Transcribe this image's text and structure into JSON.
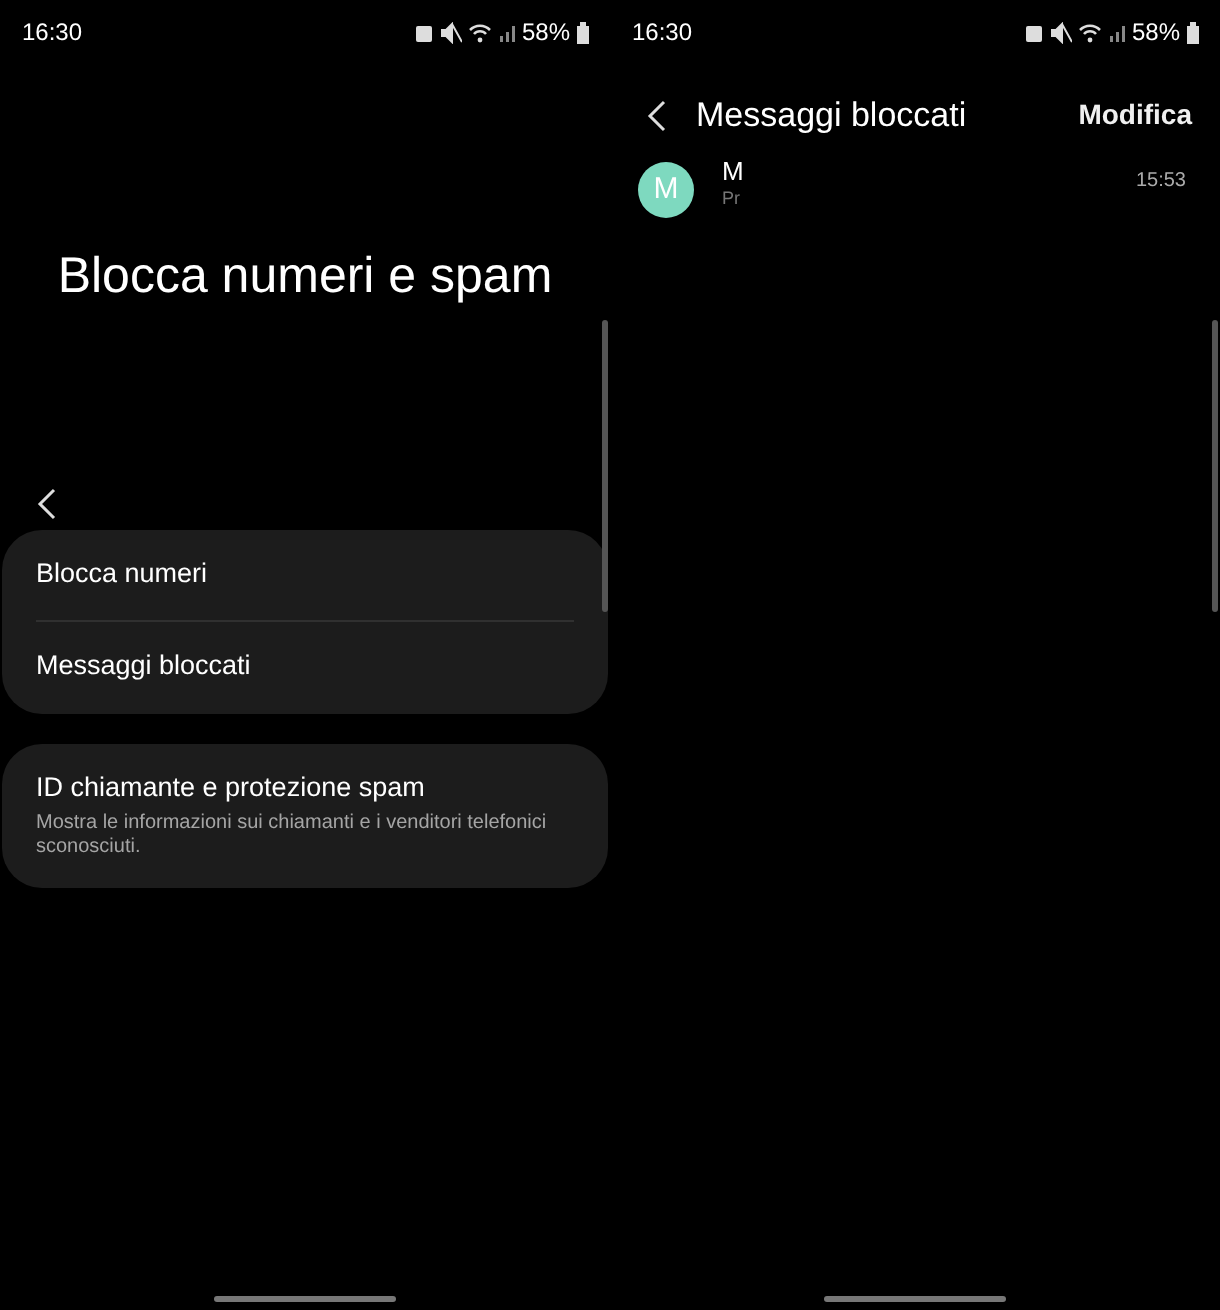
{
  "screens": [
    {
      "status_bar": {
        "time": "16:30",
        "battery": "58%"
      },
      "title": "Blocca numeri e spam",
      "groups": [
        {
          "items": [
            {
              "label": "Blocca numeri"
            },
            {
              "label": "Messaggi bloccati"
            }
          ]
        },
        {
          "items": [
            {
              "label": "ID chiamante e protezione spam",
              "description": "Mostra le informazioni sui chiamanti e i venditori telefonici sconosciuti."
            }
          ]
        }
      ]
    },
    {
      "status_bar": {
        "time": "16:30",
        "battery": "58%"
      },
      "header": {
        "title": "Messaggi bloccati",
        "action": "Modifica"
      },
      "messages": [
        {
          "initial": "M",
          "sender": "M",
          "preview": "Pr",
          "time": "15:53",
          "color": "#7ed9bf"
        }
      ]
    }
  ]
}
